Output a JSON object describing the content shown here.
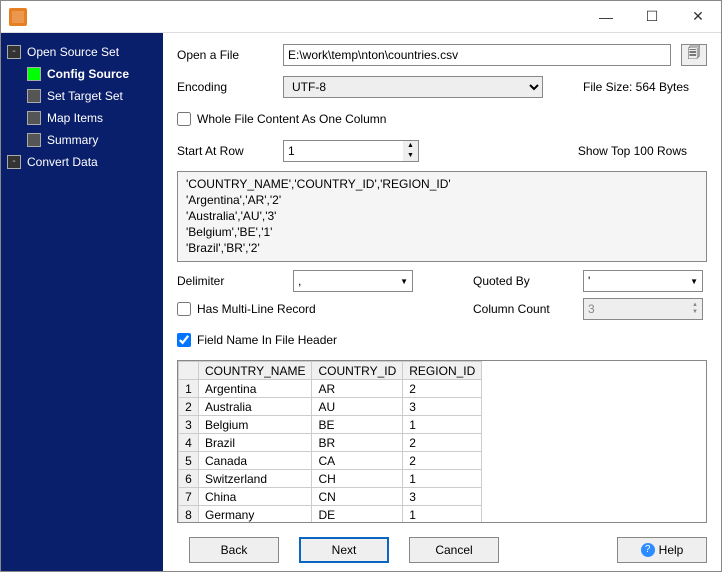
{
  "sidebar": {
    "items": [
      {
        "label": "Open Source Set",
        "type": "expand"
      },
      {
        "label": "Config Source",
        "type": "active"
      },
      {
        "label": "Set Target Set",
        "type": "leaf"
      },
      {
        "label": "Map Items",
        "type": "leaf"
      },
      {
        "label": "Summary",
        "type": "leaf"
      },
      {
        "label": "Convert Data",
        "type": "expand2"
      }
    ]
  },
  "form": {
    "open_file_label": "Open a File",
    "filepath": "E:\\work\\temp\\nton\\countries.csv",
    "encoding_label": "Encoding",
    "encoding_value": "UTF-8",
    "file_size_label": "File Size: 564 Bytes",
    "whole_file_chk": "Whole File Content As One Column",
    "whole_file_checked": false,
    "start_row_label": "Start At Row",
    "start_row_value": "1",
    "show_top_label": "Show Top 100 Rows",
    "preview_text": "'COUNTRY_NAME','COUNTRY_ID','REGION_ID'\n'Argentina','AR','2'\n'Australia','AU','3'\n'Belgium','BE','1'\n'Brazil','BR','2'",
    "delimiter_label": "Delimiter",
    "delimiter_value": ",",
    "quotedby_label": "Quoted By",
    "quotedby_value": "'",
    "multiline_chk": "Has Multi-Line Record",
    "multiline_checked": false,
    "colcount_label": "Column Count",
    "colcount_value": "3",
    "fieldname_chk": "Field Name In File Header",
    "fieldname_checked": true
  },
  "table": {
    "headers": [
      "COUNTRY_NAME",
      "COUNTRY_ID",
      "REGION_ID"
    ],
    "rows": [
      [
        "Argentina",
        "AR",
        "2"
      ],
      [
        "Australia",
        "AU",
        "3"
      ],
      [
        "Belgium",
        "BE",
        "1"
      ],
      [
        "Brazil",
        "BR",
        "2"
      ],
      [
        "Canada",
        "CA",
        "2"
      ],
      [
        "Switzerland",
        "CH",
        "1"
      ],
      [
        "China",
        "CN",
        "3"
      ],
      [
        "Germany",
        "DE",
        "1"
      ]
    ]
  },
  "buttons": {
    "back": "Back",
    "next": "Next",
    "cancel": "Cancel",
    "help": "Help"
  }
}
